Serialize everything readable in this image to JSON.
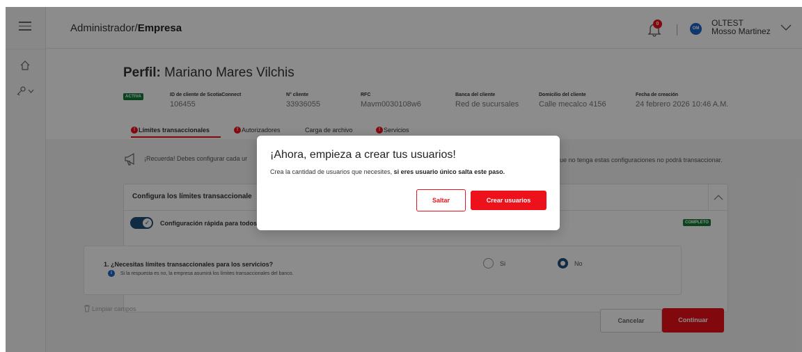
{
  "header": {
    "breadcrumb_prefix": "Administrador/",
    "breadcrumb_current": "Empresa",
    "notification_count": "0",
    "user_initials": "OM",
    "user_name": "OLTEST",
    "user_last": "Mosso Martinez"
  },
  "profile": {
    "title_label": "Perfil:",
    "title_name": "Mariano Mares Vilchis",
    "status": "ACTIVA",
    "fields": [
      {
        "label": "ID de cliente de ScotiaConnect",
        "value": "106455"
      },
      {
        "label": "N° cliente",
        "value": "33936055"
      },
      {
        "label": "RFC",
        "value": "Mavm0030108w6"
      },
      {
        "label": "Banca del cliente",
        "value": "Red de sucursales"
      },
      {
        "label": "Domicilio del cliente",
        "value": "Calle mecalco 4156"
      },
      {
        "label": "Fecha de creación",
        "value": "24 febrero 2026 10:46 A.M."
      }
    ]
  },
  "tabs": [
    {
      "label": "Límites transaccionales",
      "warn": "!",
      "active": true
    },
    {
      "label": "Autorizadores",
      "warn": "!"
    },
    {
      "label": "Carga de archivo"
    },
    {
      "label": "Servicios",
      "warn": "!"
    }
  ],
  "reminder": {
    "left": "¡Recuerda! Debes configurar cada ur",
    "right": "que no tenga estas configuraciones no podrá transaccionar."
  },
  "card": {
    "title": "Configura los límites transaccionale",
    "quick_config": "Configuración rápida para todos",
    "status": "COMPLETO",
    "question": "1. ¿Necesitas límites transaccionales para los servicios?",
    "question_info": "Si la respuesta es no, la empresa asumirá los límites transaccionales del banco.",
    "option_yes": "Si",
    "option_no": "No",
    "selected": "No"
  },
  "actions": {
    "clear": "Limpiar campos",
    "cancel": "Cancelar",
    "continue": "Continuar"
  },
  "modal": {
    "title": "¡Ahora, empieza a crear tus usuarios!",
    "text_plain": "Crea la cantidad de usuarios que necesites, ",
    "text_bold": "si eres usuario único salta este paso.",
    "skip": "Saltar",
    "create": "Crear usuarios"
  },
  "colors": {
    "accent": "#ec111a",
    "dark_blue": "#1f4f7a",
    "success": "#137c39",
    "info": "#1e64c8"
  },
  "icons": [
    "menu-icon",
    "home-icon",
    "key-icon",
    "bell-icon",
    "chevron-down-icon",
    "megaphone-icon",
    "chevron-up-icon",
    "check-icon",
    "info-icon",
    "trash-icon",
    "warning-icon"
  ]
}
